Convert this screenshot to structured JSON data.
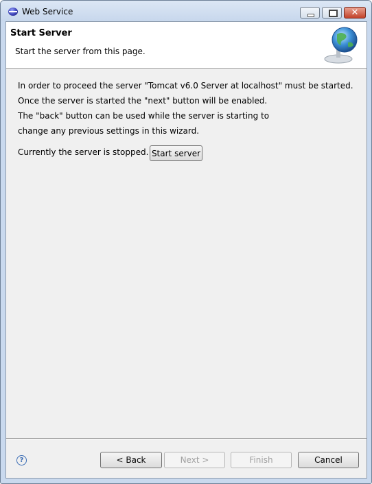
{
  "window": {
    "title": "Web Service"
  },
  "banner": {
    "title": "Start Server",
    "description": "Start the server from this page.",
    "graphic": "globe-server-icon"
  },
  "body": {
    "lines": [
      "In order to proceed the server \"Tomcat v6.0 Server at localhost\" must be started.",
      "Once the server is started the \"next\" button will be enabled.",
      "The \"back\" button can be used while the server is starting to",
      "change any previous settings in this wizard."
    ],
    "status": "Currently the server is stopped.",
    "start_label": "Start server"
  },
  "footer": {
    "help": "?",
    "back": "< Back",
    "next": "Next >",
    "finish": "Finish",
    "cancel": "Cancel"
  }
}
